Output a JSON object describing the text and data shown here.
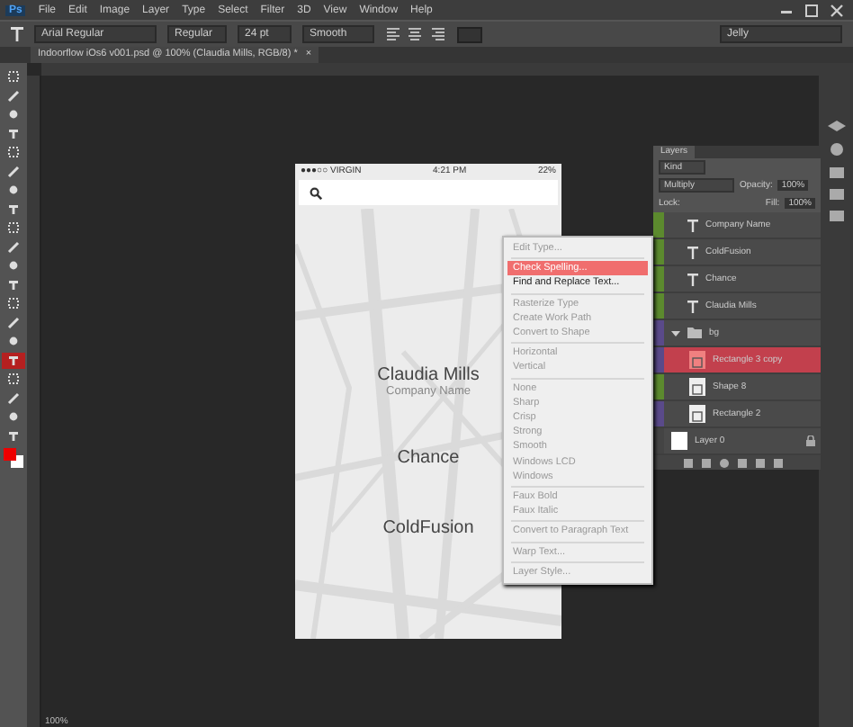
{
  "menu_bar": {
    "logo": "Ps",
    "items": [
      "File",
      "Edit",
      "Image",
      "Layer",
      "Type",
      "Select",
      "Filter",
      "3D",
      "View",
      "Window",
      "Help"
    ]
  },
  "options_bar": {
    "font_family": "Arial Regular",
    "font_style": "Regular",
    "font_size": "24 pt",
    "antialias": "Smooth",
    "workspace": "Jelly"
  },
  "document_tab": {
    "title": "Indoorflow iOs6 v001.psd @ 100% (Claudia Mills, RGB/8) *",
    "close": "×"
  },
  "tools": [
    {
      "selected": false
    },
    {
      "selected": false
    },
    {
      "selected": false
    },
    {
      "selected": false
    },
    {
      "selected": false
    },
    {
      "selected": false
    },
    {
      "selected": false
    },
    {
      "selected": false
    },
    {
      "selected": false
    },
    {
      "selected": false
    },
    {
      "selected": false
    },
    {
      "selected": false
    },
    {
      "selected": false
    },
    {
      "selected": false
    },
    {
      "selected": false
    },
    {
      "selected": true
    },
    {
      "selected": false
    },
    {
      "selected": false
    },
    {
      "selected": false
    },
    {
      "selected": false
    }
  ],
  "phone": {
    "carrier": "●●●○○ VIRGIN",
    "time": "4:21 PM",
    "battery": "22%",
    "texts": [
      {
        "kind": "name",
        "text": "Claudia Mills"
      },
      {
        "kind": "subtitle",
        "text": "Company Name"
      },
      {
        "kind": "name",
        "text": "Chance"
      },
      {
        "kind": "name",
        "text": "ColdFusion"
      }
    ]
  },
  "context_menu": {
    "groups": [
      [
        {
          "label": "Edit Type...",
          "enabled": false,
          "selected": false
        }
      ],
      [
        {
          "label": "Check Spelling...",
          "enabled": true,
          "selected": true
        },
        {
          "label": "Find and Replace Text...",
          "enabled": true,
          "selected": false
        }
      ],
      [
        {
          "label": "Rasterize Type",
          "enabled": false,
          "selected": false
        },
        {
          "label": "Create Work Path",
          "enabled": false,
          "selected": false
        },
        {
          "label": "Convert to Shape",
          "enabled": false,
          "selected": false
        }
      ],
      [
        {
          "label": "Horizontal",
          "enabled": false,
          "selected": false
        },
        {
          "label": "Vertical",
          "enabled": false,
          "selected": false
        }
      ],
      [
        {
          "label": "None",
          "enabled": false,
          "selected": false
        },
        {
          "label": "Sharp",
          "enabled": false,
          "selected": false
        },
        {
          "label": "Crisp",
          "enabled": false,
          "selected": false
        },
        {
          "label": "Strong",
          "enabled": false,
          "selected": false
        },
        {
          "label": "Smooth",
          "enabled": false,
          "selected": false
        },
        {
          "label": "Windows LCD",
          "enabled": false,
          "selected": false
        },
        {
          "label": "Windows",
          "enabled": false,
          "selected": false
        }
      ],
      [
        {
          "label": "Faux Bold",
          "enabled": false,
          "selected": false
        },
        {
          "label": "Faux Italic",
          "enabled": false,
          "selected": false
        }
      ],
      [
        {
          "label": "Convert to Paragraph Text",
          "enabled": false,
          "selected": false
        }
      ],
      [
        {
          "label": "Warp Text...",
          "enabled": false,
          "selected": false
        }
      ],
      [
        {
          "label": "Layer Style...",
          "enabled": false,
          "selected": false
        }
      ]
    ]
  },
  "layers_panel": {
    "tab": "Layers",
    "filter": "Kind",
    "blend_mode": "Multiply",
    "opacity_label": "Opacity:",
    "opacity": "100%",
    "lock_label": "Lock:",
    "fill_label": "Fill:",
    "fill": "100%",
    "layers": [
      {
        "kind": "text",
        "name": "Company Name",
        "color": "#5c8a2e",
        "selected": false
      },
      {
        "kind": "text",
        "name": "ColdFusion",
        "color": "#5c8a2e",
        "selected": false
      },
      {
        "kind": "text",
        "name": "Chance",
        "color": "#5c8a2e",
        "selected": false
      },
      {
        "kind": "text",
        "name": "Claudia Mills",
        "color": "#5c8a2e",
        "selected": false
      },
      {
        "kind": "group",
        "name": "bg",
        "color": "#5a4a8a",
        "selected": false,
        "expanded": true,
        "children": [
          {
            "kind": "shape",
            "name": "Rectangle 3 copy",
            "color": "#5a4a8a",
            "selected": true
          },
          {
            "kind": "shape",
            "name": "Shape 8",
            "color": "#5c8a2e",
            "selected": false
          },
          {
            "kind": "shape",
            "name": "Rectangle 2",
            "color": "#5a4a8a",
            "selected": false
          }
        ]
      },
      {
        "kind": "pixel",
        "name": "Layer 0",
        "color": "#444444",
        "selected": false,
        "locked": true
      }
    ]
  },
  "status_bar": {
    "zoom": "100%"
  }
}
